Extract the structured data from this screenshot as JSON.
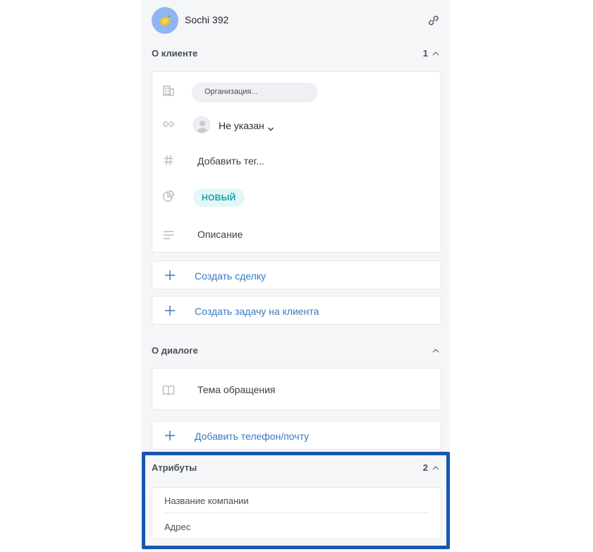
{
  "contact": {
    "name": "Sochi 392"
  },
  "about_client": {
    "title": "О клиенте",
    "count": "1",
    "organization_placeholder": "Организация...",
    "assignee": "Не указан",
    "tag_placeholder": "Добавить тег...",
    "status": "НОВЫЙ",
    "description_placeholder": "Описание"
  },
  "actions": {
    "create_deal": "Создать сделку",
    "create_task": "Создать задачу на клиента",
    "add_contact": "Добавить телефон/почту"
  },
  "about_dialog": {
    "title": "О диалоге",
    "topic_placeholder": "Тема обращения"
  },
  "attributes": {
    "title": "Атрибуты",
    "count": "2",
    "items": [
      "Название компании",
      "Адрес"
    ]
  },
  "colors": {
    "panel_bg": "#f5f6f8",
    "link_blue": "#3a78c2",
    "status_teal": "#1aa3a8",
    "status_bg": "#e3f7f7",
    "highlight": "#1a56b0",
    "avatar_bg": "#8fb6f2"
  }
}
